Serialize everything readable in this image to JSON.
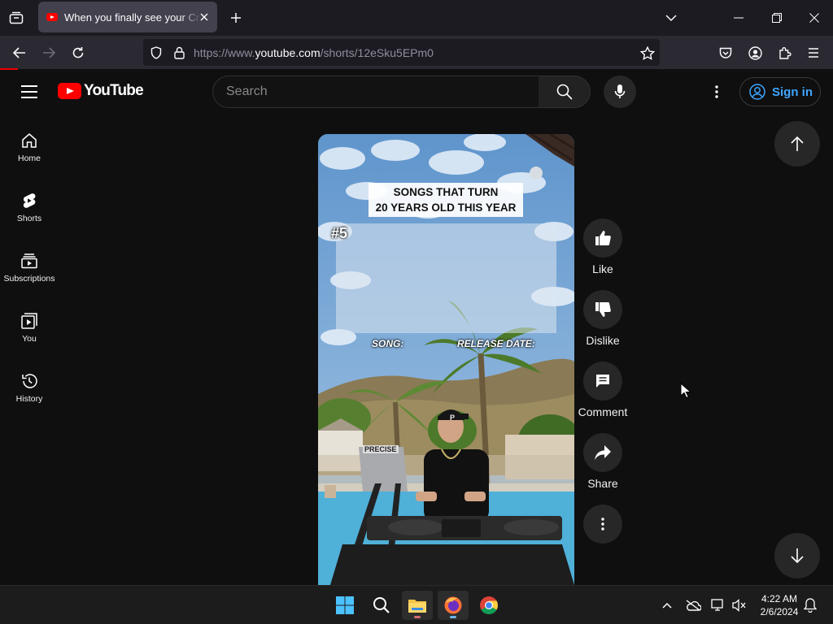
{
  "browser": {
    "tab": {
      "title": "When you finally see your Crush",
      "favicon": "youtube-favicon"
    },
    "url": {
      "prefix": "https://www.",
      "host": "youtube.com",
      "path": "/shorts/12eSku5EPm0"
    }
  },
  "header": {
    "logo_text": "YouTube",
    "search_placeholder": "Search",
    "signin_label": "Sign in"
  },
  "sidebar": {
    "items": [
      {
        "label": "Home",
        "icon": "home-icon"
      },
      {
        "label": "Shorts",
        "icon": "shorts-icon"
      },
      {
        "label": "Subscriptions",
        "icon": "subscriptions-icon"
      },
      {
        "label": "You",
        "icon": "you-icon"
      },
      {
        "label": "History",
        "icon": "history-icon"
      }
    ]
  },
  "video": {
    "caption_line1": "SONGS THAT TURN",
    "caption_line2": "20 YEARS OLD THIS YEAR",
    "rank": "#5",
    "song_label": "SONG:",
    "release_label": "RELEASE DATE:",
    "cap_letter": "P",
    "laptop_text": "PRECISE"
  },
  "actions": {
    "like": "Like",
    "dislike": "Dislike",
    "comment": "Comment",
    "share": "Share"
  },
  "taskbar": {
    "time": "4:22 AM",
    "date": "2/6/2024"
  },
  "colors": {
    "yt_red": "#ff0000",
    "link_blue": "#3ea6ff",
    "background": "#0f0f0f"
  }
}
